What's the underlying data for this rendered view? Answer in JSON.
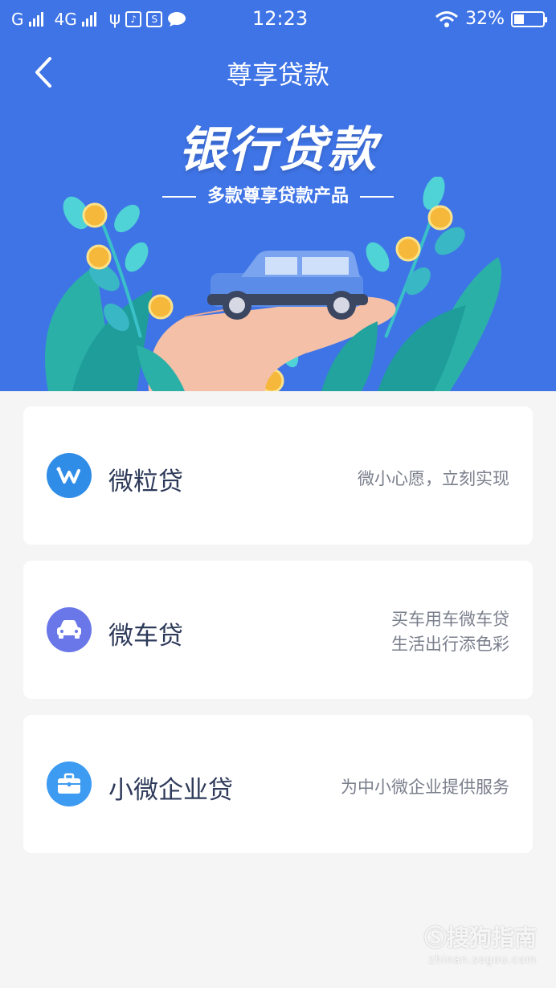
{
  "status_bar": {
    "carrier1": "G",
    "carrier2": "4G",
    "time": "12:23",
    "battery": "32%"
  },
  "header": {
    "title": "尊享贷款",
    "hero_title": "银行贷款",
    "hero_subtitle": "多款尊享贷款产品",
    "background_color": "#3f74e6"
  },
  "products": [
    {
      "name": "微粒贷",
      "desc_line1": "微小心愿，立刻实现",
      "desc_line2": "",
      "icon": "w-logo-icon",
      "icon_color": "#2f8de8"
    },
    {
      "name": "微车贷",
      "desc_line1": "买车用车微车贷",
      "desc_line2": "生活出行添色彩",
      "icon": "car-icon",
      "icon_color": "#6a77e8"
    },
    {
      "name": "小微企业贷",
      "desc_line1": "为中小微企业提供服务",
      "desc_line2": "",
      "icon": "briefcase-icon",
      "icon_color": "#3d9bf2"
    }
  ],
  "watermark": {
    "text": "搜狗指南",
    "url": "zhinan.sogou.com"
  }
}
